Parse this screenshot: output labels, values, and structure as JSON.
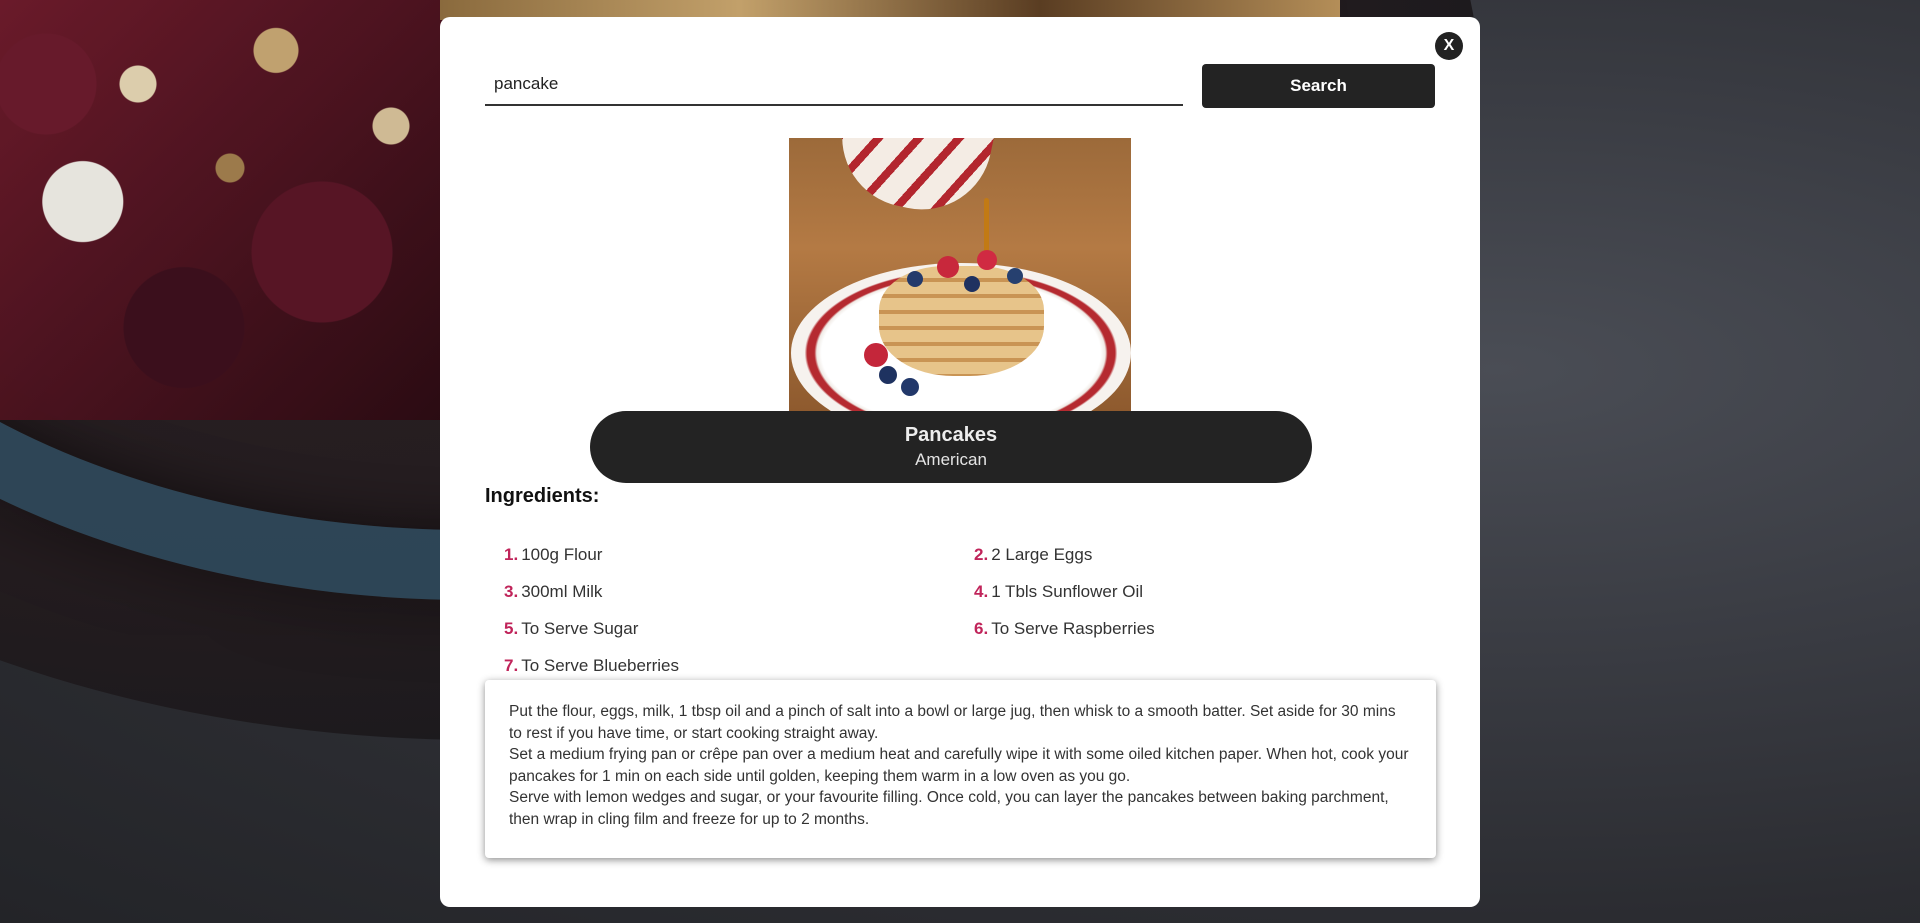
{
  "search": {
    "value": "pancake",
    "button_label": "Search"
  },
  "modal": {
    "close_label": "X"
  },
  "recipe": {
    "image_icon": "pancakes-photo",
    "name": "Pancakes",
    "area": "American",
    "ingredients_heading": "Ingredients:",
    "ingredients": [
      {
        "num": "1.",
        "text": "100g Flour"
      },
      {
        "num": "2.",
        "text": "2 Large Eggs"
      },
      {
        "num": "3.",
        "text": "300ml Milk"
      },
      {
        "num": "4.",
        "text": "1 Tbls Sunflower Oil"
      },
      {
        "num": "5.",
        "text": "To Serve Sugar"
      },
      {
        "num": "6.",
        "text": "To Serve Raspberries"
      },
      {
        "num": "7.",
        "text": "To Serve Blueberries"
      }
    ],
    "instructions": [
      "Put the flour, eggs, milk, 1 tbsp oil and a pinch of salt into a bowl or large jug, then whisk to a smooth batter. Set aside for 30 mins to rest if you have time, or start cooking straight away.",
      "Set a medium frying pan or crêpe pan over a medium heat and carefully wipe it with some oiled kitchen paper. When hot, cook your pancakes for 1 min on each side until golden, keeping them warm in a low oven as you go.",
      "Serve with lemon wedges and sugar, or your favourite filling. Once cold, you can layer the pancakes between baking parchment, then wrap in cling film and freeze for up to 2 months."
    ]
  },
  "colors": {
    "accent_number": "#c0245a",
    "dark": "#232323",
    "modal_bg": "#ffffff"
  }
}
